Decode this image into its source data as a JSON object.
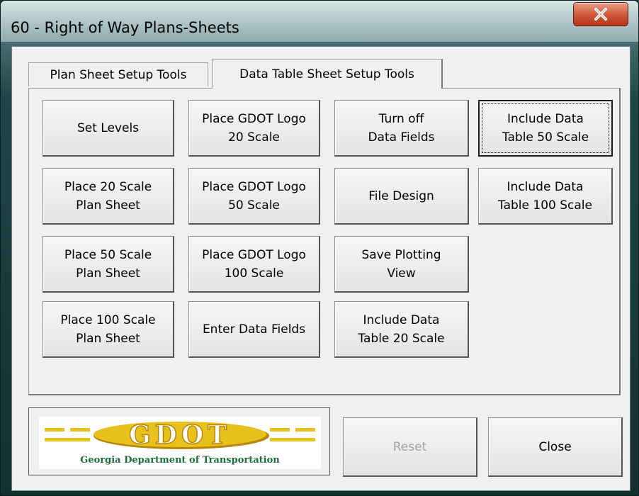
{
  "window": {
    "title": "60 - Right of Way Plans-Sheets",
    "close_glyph": "X"
  },
  "tabs": [
    {
      "label": "Plan Sheet Setup Tools",
      "active": false
    },
    {
      "label": "Data Table Sheet Setup Tools",
      "active": true
    }
  ],
  "buttons": {
    "set_levels": "Set Levels",
    "place_gdot_logo_20": "Place GDOT Logo\n20 Scale",
    "turn_off_data_fields": "Turn off\nData Fields",
    "include_data_table_50": "Include Data\nTable 50 Scale",
    "place_20_plan_sheet": "Place 20 Scale\nPlan Sheet",
    "place_gdot_logo_50": "Place GDOT Logo\n50 Scale",
    "file_design": "File Design",
    "include_data_table_100": "Include Data\nTable 100 Scale",
    "place_50_plan_sheet": "Place 50 Scale\nPlan Sheet",
    "place_gdot_logo_100": "Place GDOT Logo\n100 Scale",
    "save_plotting_view": "Save Plotting\nView",
    "place_100_plan_sheet": "Place 100 Scale\nPlan Sheet",
    "enter_data_fields": "Enter Data Fields",
    "include_data_table_20": "Include Data\nTable 20 Scale"
  },
  "footer": {
    "logo_text": "GDOT",
    "logo_caption": "Georgia Department of Transportation",
    "reset_label": "Reset",
    "close_label": "Close"
  },
  "colors": {
    "logo_gold": "#e8c21c",
    "logo_gold_dark": "#b8860b",
    "logo_caption_green": "#1a6e3a",
    "close_button_red": "#c8482c"
  }
}
